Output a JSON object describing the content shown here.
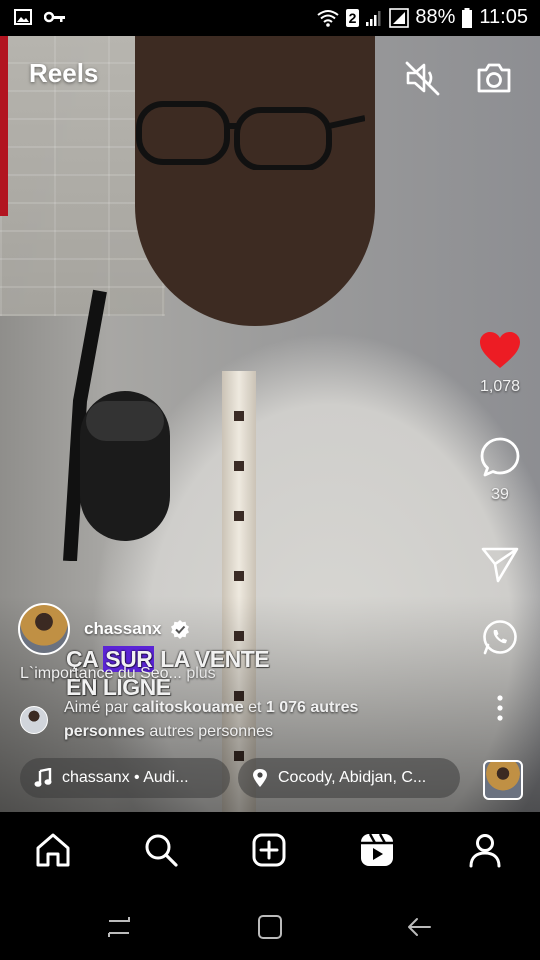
{
  "status_bar": {
    "signal_badge": "2",
    "battery": "88%",
    "time": "11:05",
    "icons": [
      "image-icon",
      "key-icon",
      "wifi-icon",
      "signal-icon",
      "battery-icon"
    ]
  },
  "header": {
    "title": "Reels",
    "mute_icon": "volume-mute-icon",
    "camera_icon": "camera-icon"
  },
  "actions": {
    "like_count": "1,078",
    "comment_count": "39",
    "like_color": "#ed1c24"
  },
  "post": {
    "author": "chassanx",
    "overlay_line1_a": "ÇA ",
    "overlay_line1_hl": "SUR",
    "overlay_line1_b": " LA VENTE",
    "overlay_line2": "EN LIGNE",
    "caption": "L`importance du Seo...",
    "more_label": "plus",
    "liked_prefix": "Aimé par ",
    "liked_user": "calitoskouame",
    "liked_mid": " et ",
    "liked_count": "1 076 autres",
    "liked_people": "personnes",
    "liked_suffix": " autres personnes"
  },
  "chips": {
    "audio": "chassanx • Audi...",
    "location": "Cocody, Abidjan, C..."
  },
  "bottom_nav": [
    "home-icon",
    "search-icon",
    "create-icon",
    "reels-icon",
    "profile-icon"
  ],
  "accent_purple": "#5b24d6"
}
